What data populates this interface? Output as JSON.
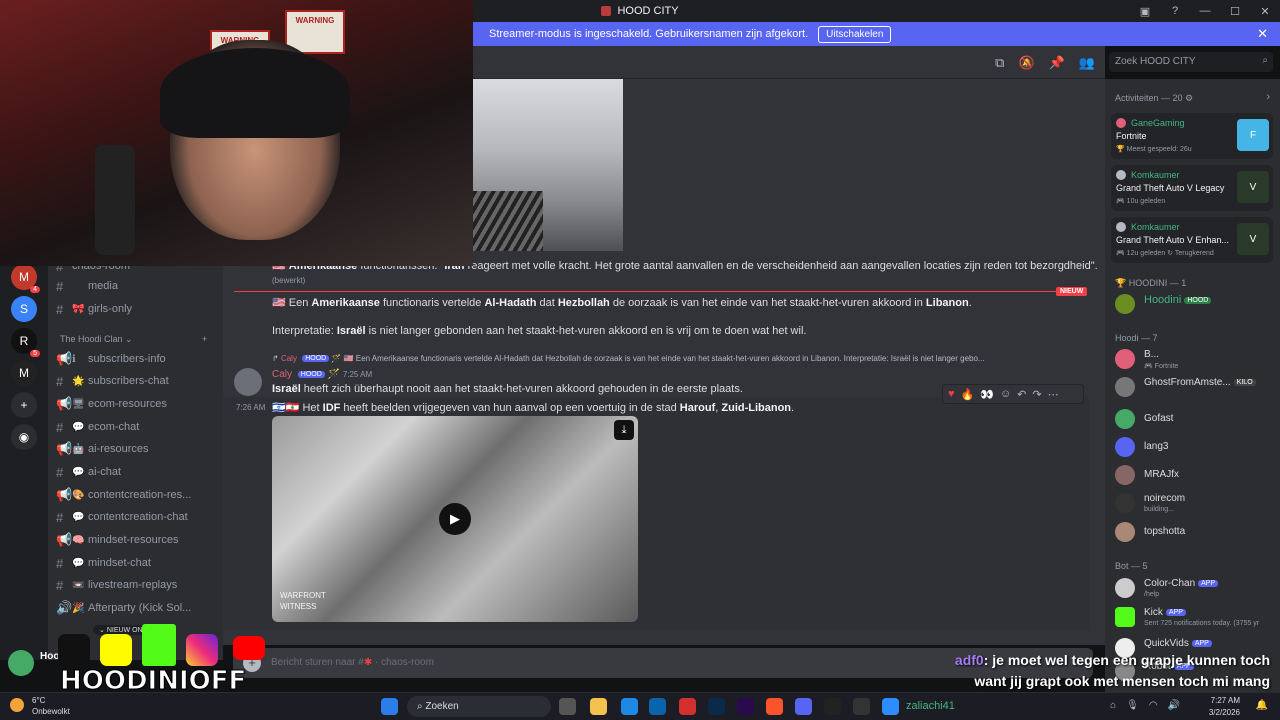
{
  "window": {
    "title": "HOOD CITY"
  },
  "banner": {
    "text": "Streamer-modus is ingeschakeld. Gebruikersnamen zijn afgekort.",
    "button": "Uitschakelen"
  },
  "search": {
    "placeholder": "Zoek HOOD CITY"
  },
  "sidebar": {
    "channels": [
      {
        "name": "chaos-room"
      },
      {
        "name": "media"
      },
      {
        "name": "girls-only"
      }
    ],
    "category": "The Hoodi Clan",
    "clan_channels": [
      {
        "name": "subscribers-info"
      },
      {
        "name": "subscribers-chat"
      },
      {
        "name": "ecom-resources"
      },
      {
        "name": "ecom-chat"
      },
      {
        "name": "ai-resources"
      },
      {
        "name": "ai-chat"
      },
      {
        "name": "contentcreation-res..."
      },
      {
        "name": "contentcreation-chat"
      },
      {
        "name": "mindset-resources"
      },
      {
        "name": "mindset-chat"
      },
      {
        "name": "livestream-replays"
      },
      {
        "name": "Afterparty (Kick Sol..."
      }
    ],
    "new_pill": "NIEUW ON",
    "server_badges": [
      "4",
      "5"
    ]
  },
  "messages": {
    "top_line_tag": "Amerikaanse",
    "top_line_mid": "functionarissen:",
    "top_line_bold": "Iran",
    "top_line": "reageert met volle kracht. Het grote aantal aanvallen en de verscheidenheid aan aangevallen locaties zijn reden tot bezorgdheid\".",
    "edited": "(bewerkt)",
    "new_label": "NIEUW",
    "m1_pre": "Een ",
    "m1_b1": "Amerikaanse",
    "m1_t1": " functionaris vertelde ",
    "m1_b2": "Al-Hadath",
    "m1_t2": " dat ",
    "m1_b3": "Hezbollah",
    "m1_t3": " de oorzaak is van het einde van het staakt-het-vuren akkoord in ",
    "m1_b4": "Libanon",
    "m1_t4": ".",
    "m2_t1": "Interpretatie: ",
    "m2_b1": "Israël",
    "m2_t2": " is niet langer gebonden aan het staakt-het-vuren akkoord en is vrij om te doen wat het wil.",
    "reply_user": "Caly",
    "reply_tag": "HOOD",
    "reply_text": "Een Amerikaanse functionaris vertelde Al-Hadath dat Hezbollah de oorzaak is van het einde van het staakt-het-vuren akkoord in Libanon.  Interpretatie: Israël is niet langer gebo...",
    "author": "Caly",
    "author_tag": "HOOD",
    "author_time": "7:25 AM",
    "m3_b1": "Israël",
    "m3_t1": " heeft zich überhaupt nooit aan het staakt-het-vuren akkoord gehouden in de eerste plaats.",
    "m4_time": "7:26 AM",
    "m4_t1": "Het ",
    "m4_b1": "IDF",
    "m4_t2": " heeft beelden vrijgegeven van hun aanval op een voertuig in de stad ",
    "m4_b2": "Harouf",
    "m4_t3": ", ",
    "m4_b3": "Zuid-Libanon",
    "m4_t4": ".",
    "video_watermark_1": "WARFRONT",
    "video_watermark_2": "WITNESS"
  },
  "composer": {
    "placeholder": "Bericht sturen naar #",
    "channel": "chaos-room"
  },
  "members": {
    "activities_header": "Activiteiten — 20",
    "activities": [
      {
        "user": "GaneGaming",
        "game": "Fortnite",
        "sub": "Meest gespeeld: 26u",
        "art": "F"
      },
      {
        "user": "Komkaumer",
        "game": "Grand Theft Auto V Legacy",
        "sub": "10u geleden",
        "art": "V"
      },
      {
        "user": "Komkaumer",
        "game": "Grand Theft Auto V Enhan...",
        "sub": "12u geleden",
        "sub2": "Terugkerend",
        "art": "V"
      }
    ],
    "hoodini_header": "HOODINI — 1",
    "hoodini": [
      {
        "name": "Hoodini",
        "tag": "HOOD"
      }
    ],
    "hoodi_header": "Hoodi — 7",
    "hoodi": [
      {
        "name": "B...",
        "status": "Fortnite"
      },
      {
        "name": "GhostFromAmste...",
        "tag": "KILO"
      },
      {
        "name": "Gofast"
      },
      {
        "name": "lang3"
      },
      {
        "name": "MRAJfx"
      },
      {
        "name": "noirecom",
        "status": "building..."
      },
      {
        "name": "topshotta"
      }
    ],
    "bot_header": "Bot — 5",
    "bots": [
      {
        "name": "Color-Chan",
        "tag": "APP",
        "status": "/help"
      },
      {
        "name": "Kick",
        "tag": "APP",
        "status": "Sent 725 notifications today. (3755 yr"
      },
      {
        "name": "QuickVids",
        "tag": "APP"
      },
      {
        "name": "Robot",
        "tag": "APP"
      }
    ]
  },
  "overlay": {
    "name": "HOODINIOFF",
    "caption_user": "adf0",
    "caption_line1": "je moet wel tegen een grapje kunnen toch",
    "caption_line2": "want jij grapt ook met mensen toch mi mang",
    "hood_label": "Hood"
  },
  "taskbar": {
    "temp": "6°C",
    "weather": "Onbewolkt",
    "search": "Zoeken",
    "tray_label": "zaliachi41",
    "time": "7:27 AM",
    "date": "3/2/2026"
  },
  "colors": {
    "accent": "#5865f2",
    "new": "#f23f43",
    "online": "#43b581"
  }
}
